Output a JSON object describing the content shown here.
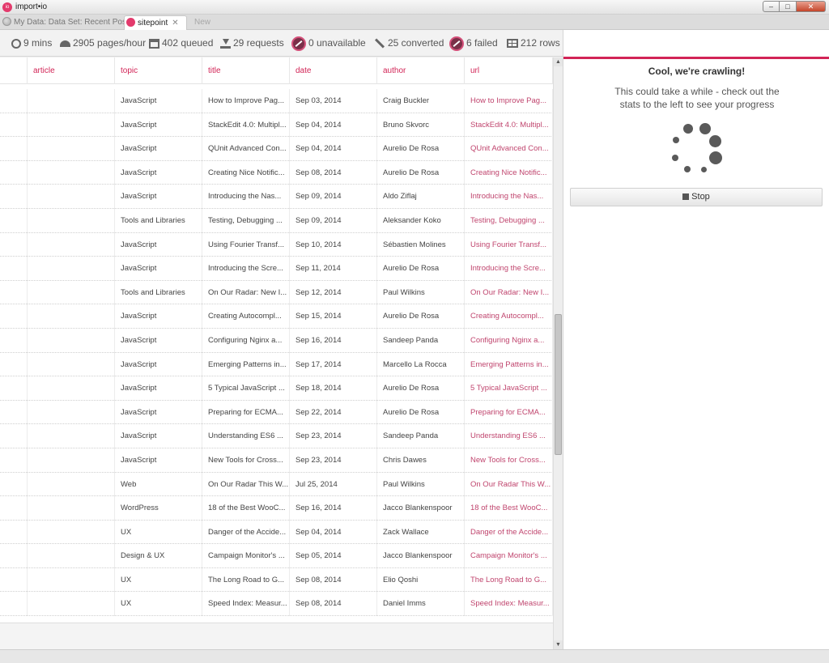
{
  "window": {
    "title": "import•io",
    "logo_text": "io",
    "controls": [
      "–",
      "□",
      "✕"
    ]
  },
  "tabs": [
    {
      "label": "My Data: Data Set: Recent Posts",
      "icon": "globe-icon",
      "active": false
    },
    {
      "label": "sitepoint",
      "icon": "importio-logo-icon",
      "active": true,
      "close": "✕"
    },
    {
      "label": "New",
      "active": false
    }
  ],
  "stats": [
    {
      "icon": "clock-icon",
      "text": "9 mins"
    },
    {
      "icon": "gauge-icon",
      "text": "2905 pages/hour"
    },
    {
      "icon": "queue-icon",
      "text": "402 queued"
    },
    {
      "icon": "download-icon",
      "text": "29 requests"
    },
    {
      "icon": "ban-icon",
      "text": "0 unavailable"
    },
    {
      "icon": "wand-icon",
      "text": "25 converted"
    },
    {
      "icon": "ban-icon",
      "text": "6 failed"
    },
    {
      "icon": "table-icon",
      "text": "212 rows"
    }
  ],
  "table": {
    "columns": [
      "",
      "article",
      "topic",
      "title",
      "date",
      "author",
      "url"
    ],
    "rows": [
      [
        "JavaScript",
        "How to Improve Pag...",
        "Sep 03, 2014",
        "Craig Buckler",
        "How to Improve Pag..."
      ],
      [
        "JavaScript",
        "StackEdit 4.0: Multipl...",
        "Sep 04, 2014",
        "Bruno Skvorc",
        "StackEdit 4.0: Multipl..."
      ],
      [
        "JavaScript",
        "QUnit Advanced Con...",
        "Sep 04, 2014",
        "Aurelio De Rosa",
        "QUnit Advanced Con..."
      ],
      [
        "JavaScript",
        "Creating Nice Notific...",
        "Sep 08, 2014",
        "Aurelio De Rosa",
        "Creating Nice Notific..."
      ],
      [
        "JavaScript",
        "Introducing the Nas...",
        "Sep 09, 2014",
        "Aldo Ziflaj",
        "Introducing the Nas..."
      ],
      [
        "Tools and Libraries",
        "Testing, Debugging ...",
        "Sep 09, 2014",
        "Aleksander Koko",
        "Testing, Debugging ..."
      ],
      [
        "JavaScript",
        "Using Fourier Transf...",
        "Sep 10, 2014",
        "Sébastien Molines",
        "Using Fourier Transf..."
      ],
      [
        "JavaScript",
        "Introducing the Scre...",
        "Sep 11, 2014",
        "Aurelio De Rosa",
        "Introducing the Scre..."
      ],
      [
        "Tools and Libraries",
        "On Our Radar: New I...",
        "Sep 12, 2014",
        "Paul Wilkins",
        "On Our Radar: New I..."
      ],
      [
        "JavaScript",
        "Creating Autocompl...",
        "Sep 15, 2014",
        "Aurelio De Rosa",
        "Creating Autocompl..."
      ],
      [
        "JavaScript",
        "Configuring Nginx a...",
        "Sep 16, 2014",
        "Sandeep Panda",
        "Configuring Nginx a..."
      ],
      [
        "JavaScript",
        "Emerging Patterns in...",
        "Sep 17, 2014",
        "Marcello La Rocca",
        "Emerging Patterns in..."
      ],
      [
        "JavaScript",
        "5 Typical JavaScript ...",
        "Sep 18, 2014",
        "Aurelio De Rosa",
        "5 Typical JavaScript ..."
      ],
      [
        "JavaScript",
        "Preparing for ECMA...",
        "Sep 22, 2014",
        "Aurelio De Rosa",
        "Preparing for ECMA..."
      ],
      [
        "JavaScript",
        "Understanding ES6 ...",
        "Sep 23, 2014",
        "Sandeep Panda",
        "Understanding ES6 ..."
      ],
      [
        "JavaScript",
        "New Tools for Cross...",
        "Sep 23, 2014",
        "Chris Dawes",
        "New Tools for Cross..."
      ],
      [
        "Web",
        "On Our Radar This W...",
        "Jul 25, 2014",
        "Paul Wilkins",
        "On Our Radar This W..."
      ],
      [
        "WordPress",
        "18 of the Best WooC...",
        "Sep 16, 2014",
        "Jacco Blankenspoor",
        "18 of the Best WooC..."
      ],
      [
        "UX",
        "Danger of the Accide...",
        "Sep 04, 2014",
        "Zack Wallace",
        "Danger of the Accide..."
      ],
      [
        "Design & UX",
        "Campaign Monitor's ...",
        "Sep 05, 2014",
        "Jacco Blankenspoor",
        "Campaign Monitor's ..."
      ],
      [
        "UX",
        "The Long Road to G...",
        "Sep 08, 2014",
        "Elio Qoshi",
        "The Long Road to G..."
      ],
      [
        "UX",
        "Speed Index: Measur...",
        "Sep 08, 2014",
        "Daniel Imms",
        "Speed Index: Measur..."
      ]
    ]
  },
  "scrollbar": {
    "up": "▲",
    "down": "▼"
  },
  "panel": {
    "title": "Cool, we're crawling!",
    "message": "This could take a while - check out the stats to the left to see your progress",
    "stop_label": "Stop"
  },
  "colors": {
    "accent": "#d22456",
    "url_text": "#c0456e"
  }
}
